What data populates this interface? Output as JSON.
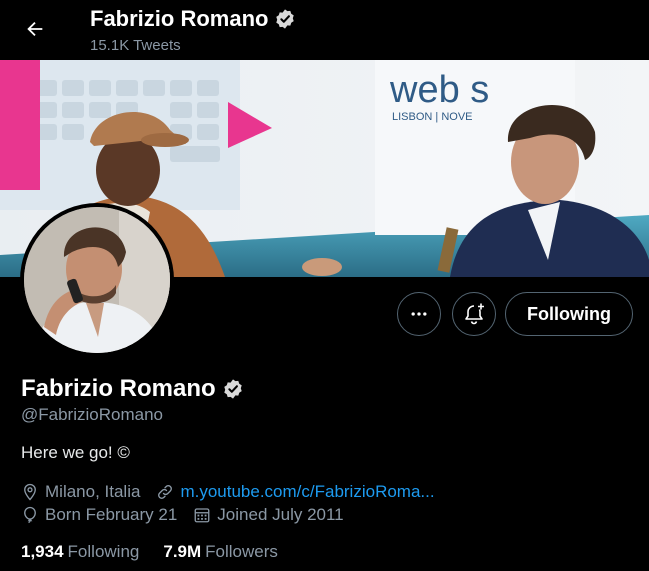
{
  "header": {
    "name": "Fabrizio Romano",
    "tweet_count": "15.1K Tweets"
  },
  "icons": {
    "back": "arrow-left-icon",
    "verified": "verified-badge-icon",
    "more": "more-dots-icon",
    "notify": "bell-plus-icon",
    "location": "location-pin-icon",
    "link": "link-icon",
    "birthday": "balloon-icon",
    "joined": "calendar-icon"
  },
  "banner": {
    "sign_text": "web s",
    "sign_subtext": "LISBON | NOVE"
  },
  "actions": {
    "follow_label": "Following"
  },
  "profile": {
    "name": "Fabrizio Romano",
    "handle": "@FabrizioRomano",
    "bio": "Here we go! ©",
    "location": "Milano, Italia",
    "website": "m.youtube.com/c/FabrizioRoma...",
    "birthday": "Born February 21",
    "joined": "Joined July 2011"
  },
  "stats": {
    "following_count": "1,934",
    "following_label": "Following",
    "followers_count": "7.9M",
    "followers_label": "Followers"
  },
  "colors": {
    "background": "#000000",
    "text": "#e7e9ea",
    "secondary": "#8b98a5",
    "link": "#1d9bf0",
    "border": "#536471"
  }
}
